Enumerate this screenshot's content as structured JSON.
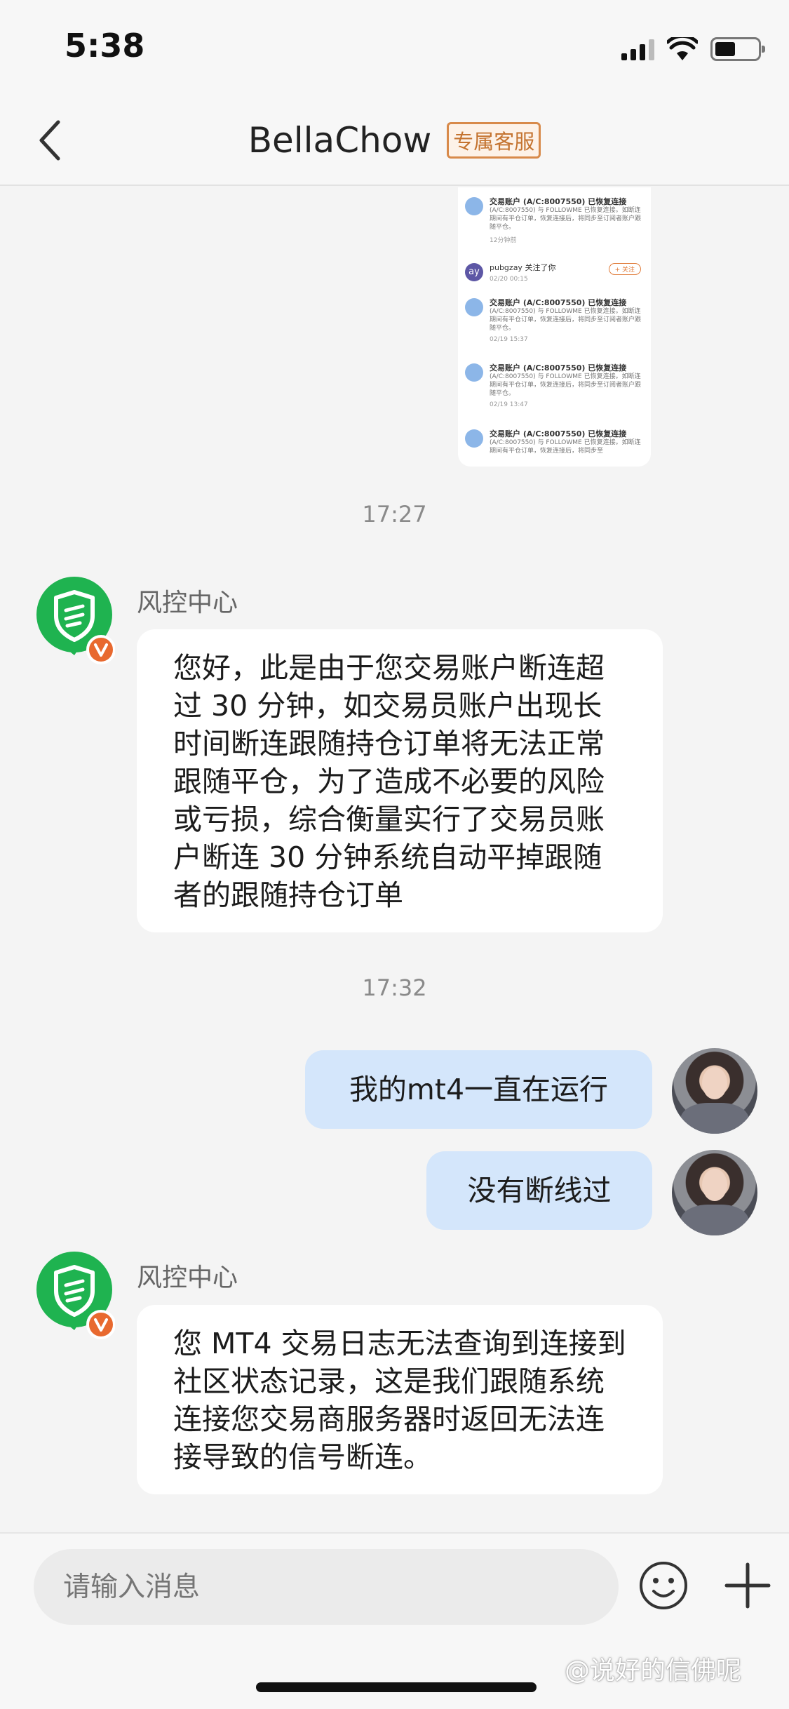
{
  "status_bar": {
    "time": "5:38"
  },
  "nav": {
    "title": "BellaChow",
    "badge": "专属客服"
  },
  "screenshot_preview": {
    "entries": [
      {
        "title": "交易账户 (A/C:8007550) 已恢复连接",
        "body": "(A/C:8007550) 与 FOLLOWME 已恢复连接。如断连期间有平仓订单，恢复连接后，将同步至订阅者账户跟随平仓。",
        "time": "12分钟前"
      },
      {
        "title": "pubgzay 关注了你",
        "body": "",
        "time": "02/20 00:15",
        "avatar_text": "ay",
        "follow_label": "+ 关注"
      },
      {
        "title": "交易账户 (A/C:8007550) 已恢复连接",
        "body": "(A/C:8007550) 与 FOLLOWME 已恢复连接。如断连期间有平仓订单，恢复连接后，将同步至订阅者账户跟随平仓。",
        "time": "02/19 15:37"
      },
      {
        "title": "交易账户 (A/C:8007550) 已恢复连接",
        "body": "(A/C:8007550) 与 FOLLOWME 已恢复连接。如断连期间有平仓订单，恢复连接后，将同步至订阅者账户跟随平仓。",
        "time": "02/19 13:47"
      },
      {
        "title": "交易账户 (A/C:8007550) 已恢复连接",
        "body": "(A/C:8007550) 与 FOLLOWME 已恢复连接。如断连期间有平仓订单，恢复连接后，将同步至",
        "time": ""
      }
    ]
  },
  "messages": [
    {
      "kind": "time",
      "text": "17:27"
    },
    {
      "kind": "incoming",
      "sender": "风控中心",
      "text": "您好，此是由于您交易账户断连超过 30 分钟，如交易员账户出现长时间断连跟随持仓订单将无法正常跟随平仓，为了造成不必要的风险或亏损，综合衡量实行了交易员账户断连 30 分钟系统自动平掉跟随者的跟随持仓订单"
    },
    {
      "kind": "time",
      "text": "17:32"
    },
    {
      "kind": "outgoing",
      "text": "我的mt4一直在运行"
    },
    {
      "kind": "outgoing",
      "text": "没有断线过"
    },
    {
      "kind": "incoming",
      "sender": "风控中心",
      "text": "您 MT4 交易日志无法查询到连接到社区状态记录，这是我们跟随系统连接您交易商服务器时返回无法连接导致的信号断连。"
    }
  ],
  "input": {
    "placeholder": "请输入消息"
  },
  "watermark": "@说好的信佛呢",
  "colors": {
    "bubble_out": "#d4e6fb",
    "bubble_in": "#ffffff",
    "badge": "#c4732f",
    "shield_green": "#1fb350",
    "verify_orange": "#e8692f"
  }
}
